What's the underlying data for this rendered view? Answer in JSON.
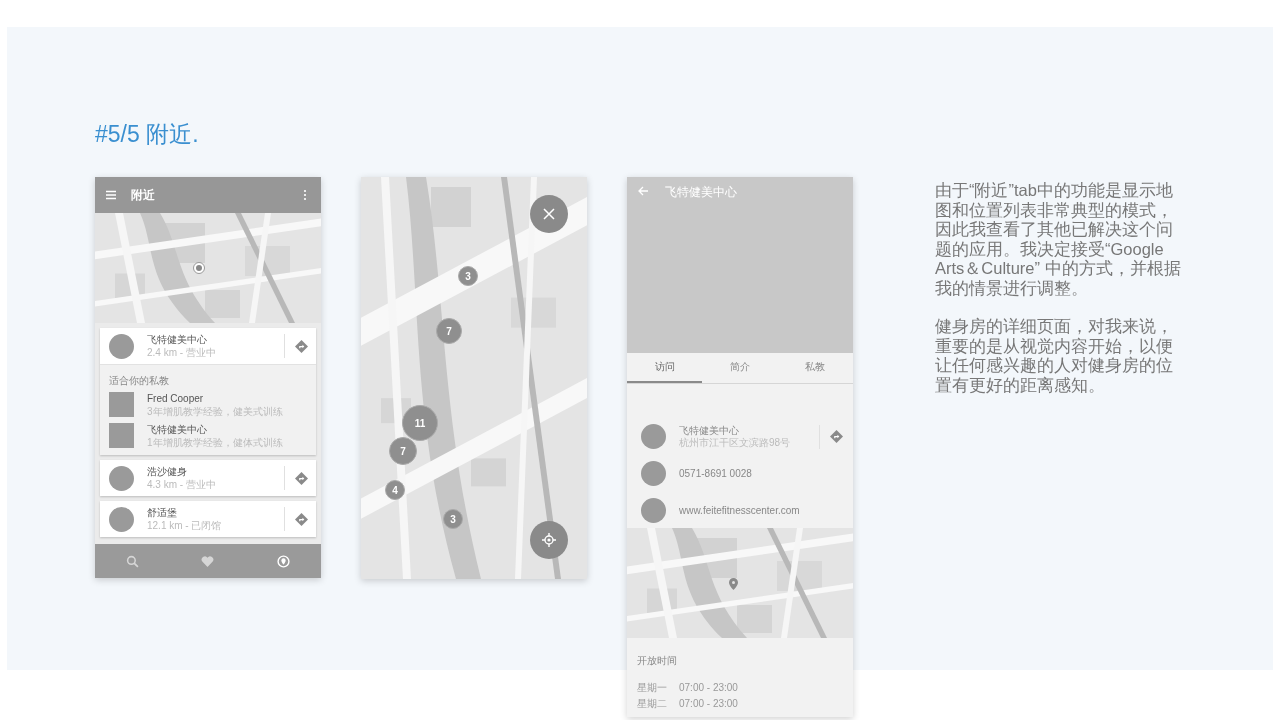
{
  "heading": "#5/5 附近.",
  "list_screen": {
    "title": "附近",
    "places": [
      {
        "name": "飞特健美中心",
        "meta": "2.4 km - 营业中",
        "expanded": true,
        "trainers_label": "适合你的私教",
        "trainers": [
          {
            "name": "Fred Cooper",
            "info": "3年增肌教学经验，健美式训练"
          },
          {
            "name": "飞特健美中心",
            "info": "1年增肌教学经验，健体式训练"
          }
        ]
      },
      {
        "name": "浩沙健身",
        "meta": "4.3 km - 营业中",
        "expanded": false
      },
      {
        "name": "舒适堡",
        "meta": "12.1 km - 已闭馆",
        "expanded": false
      }
    ],
    "nav": [
      {
        "kind": "search",
        "selected": false
      },
      {
        "kind": "heart",
        "selected": false
      },
      {
        "kind": "pin",
        "selected": true
      }
    ]
  },
  "map_screen": {
    "clusters": [
      {
        "count": "3"
      },
      {
        "count": "7"
      },
      {
        "count": "11"
      },
      {
        "count": "7"
      },
      {
        "count": "4"
      },
      {
        "count": "3"
      }
    ]
  },
  "detail_screen": {
    "title": "飞特健美中心",
    "tabs": [
      {
        "label": "访问",
        "selected": true
      },
      {
        "label": "简介",
        "selected": false
      },
      {
        "label": "私教",
        "selected": false
      }
    ],
    "contact": [
      {
        "kind": "address",
        "text": "飞特健美中心",
        "subtext": "杭州市江干区文滨路98号"
      },
      {
        "kind": "phone",
        "text": "0571-8691 0028"
      },
      {
        "kind": "web",
        "text": "www.feitefitnesscenter.com"
      }
    ],
    "hours_label": "开放时间",
    "hours": [
      {
        "day": "星期一",
        "time": "07:00 - 23:00"
      },
      {
        "day": "星期二",
        "time": "07:00 - 23:00"
      }
    ]
  },
  "description": [
    "由于“附近”tab中的功能是显示地图和位置列表非常典型的模式，因此我查看了其他已解决这个问题的应用。我决定接受“Google Arts＆Culture” 中的方式，并根据我的情景进行调整。",
    "健身房的详细页面，对我来说，重要的是从视觉内容开始，以便让任何感兴趣的人对健身房的位置有更好的距离感知。"
  ]
}
